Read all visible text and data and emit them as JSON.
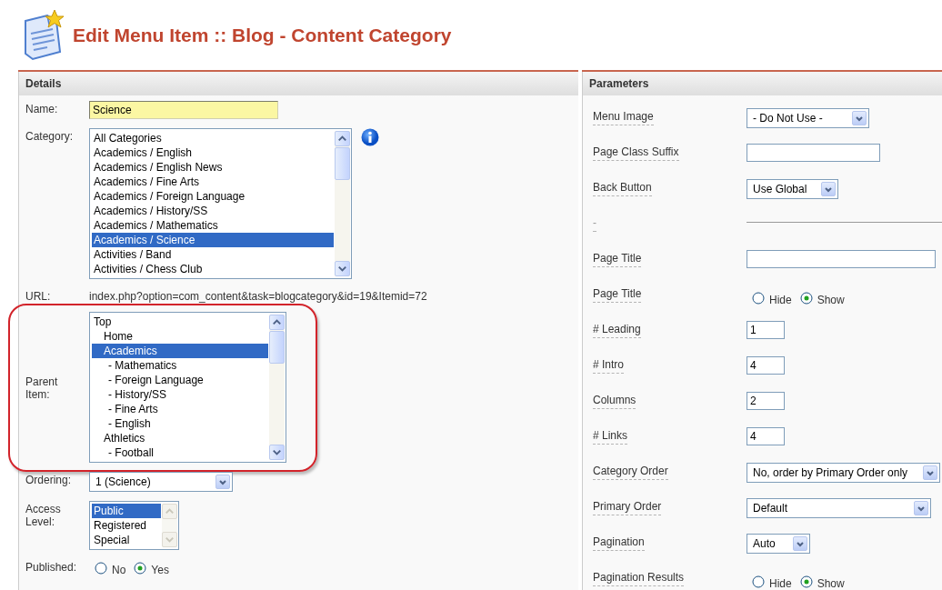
{
  "page_title": "Edit Menu Item :: Blog - Content Category",
  "details": {
    "heading": "Details",
    "fields": [
      {
        "kind": "text",
        "label": "Name:",
        "value": "Science",
        "focused": true
      },
      {
        "kind": "listbox",
        "label": "Category:",
        "info": true,
        "scroll_disabled": false,
        "items": [
          {
            "label": "All Categories",
            "selected": false
          },
          {
            "label": "Academics / English",
            "selected": false
          },
          {
            "label": "Academics / English News",
            "selected": false
          },
          {
            "label": "Academics / Fine Arts",
            "selected": false
          },
          {
            "label": "Academics / Foreign Language",
            "selected": false
          },
          {
            "label": "Academics / History/SS",
            "selected": false
          },
          {
            "label": "Academics / Mathematics",
            "selected": false
          },
          {
            "label": "Academics / Science",
            "selected": true
          },
          {
            "label": "Activities / Band",
            "selected": false
          },
          {
            "label": "Activities / Chess Club",
            "selected": false
          }
        ]
      },
      {
        "kind": "static",
        "label": "URL:",
        "value": "index.php?option=com_content&task=blogcategory&id=19&Itemid=72"
      },
      {
        "kind": "tree",
        "label": "Parent Item:",
        "highlighted": true,
        "scroll_disabled": false,
        "items": [
          {
            "label": "Top",
            "selected": false,
            "children": [
              {
                "label": "Home",
                "selected": false
              },
              {
                "label": "Academics",
                "selected": true,
                "children": [
                  {
                    "label": "- Mathematics",
                    "selected": false
                  },
                  {
                    "label": "- Foreign Language",
                    "selected": false
                  },
                  {
                    "label": "- History/SS",
                    "selected": false
                  },
                  {
                    "label": "- Fine Arts",
                    "selected": false
                  },
                  {
                    "label": "- English",
                    "selected": false
                  }
                ]
              },
              {
                "label": "Athletics",
                "selected": false,
                "children": [
                  {
                    "label": "- Football",
                    "selected": false
                  }
                ]
              }
            ]
          }
        ]
      },
      {
        "kind": "select",
        "label": "Ordering:",
        "value": "1 (Science)"
      },
      {
        "kind": "listbox",
        "label": "Access Level:",
        "scroll_disabled": true,
        "items": [
          {
            "label": "Public",
            "selected": true
          },
          {
            "label": "Registered",
            "selected": false
          },
          {
            "label": "Special",
            "selected": false
          }
        ]
      },
      {
        "kind": "radio",
        "label": "Published:",
        "options": [
          {
            "label": "No",
            "selected": false
          },
          {
            "label": "Yes",
            "selected": true
          }
        ]
      }
    ]
  },
  "parameters": {
    "heading": "Parameters",
    "fields": [
      {
        "kind": "select",
        "label": "Menu Image",
        "value": "- Do Not Use -"
      },
      {
        "kind": "text",
        "label": "Page Class Suffix"
      },
      {
        "kind": "select",
        "label": "Back Button",
        "value": "Use Global"
      },
      {
        "kind": "separator",
        "label": "-"
      },
      {
        "kind": "text",
        "label": "Page Title"
      },
      {
        "kind": "radio",
        "label": "Page Title",
        "options": [
          {
            "label": "Hide",
            "selected": false
          },
          {
            "label": "Show",
            "selected": true
          }
        ]
      },
      {
        "kind": "text",
        "label": "# Leading",
        "value": "1"
      },
      {
        "kind": "text",
        "label": "# Intro",
        "value": "4"
      },
      {
        "kind": "text",
        "label": "Columns",
        "value": "2"
      },
      {
        "kind": "text",
        "label": "# Links",
        "value": "4"
      },
      {
        "kind": "select",
        "label": "Category Order",
        "value": "No, order by Primary Order only"
      },
      {
        "kind": "select",
        "label": "Primary Order",
        "value": "Default"
      },
      {
        "kind": "select",
        "label": "Pagination",
        "value": "Auto"
      },
      {
        "kind": "radio",
        "label": "Pagination Results",
        "options": [
          {
            "label": "Hide",
            "selected": false
          },
          {
            "label": "Show",
            "selected": true
          }
        ]
      }
    ]
  }
}
